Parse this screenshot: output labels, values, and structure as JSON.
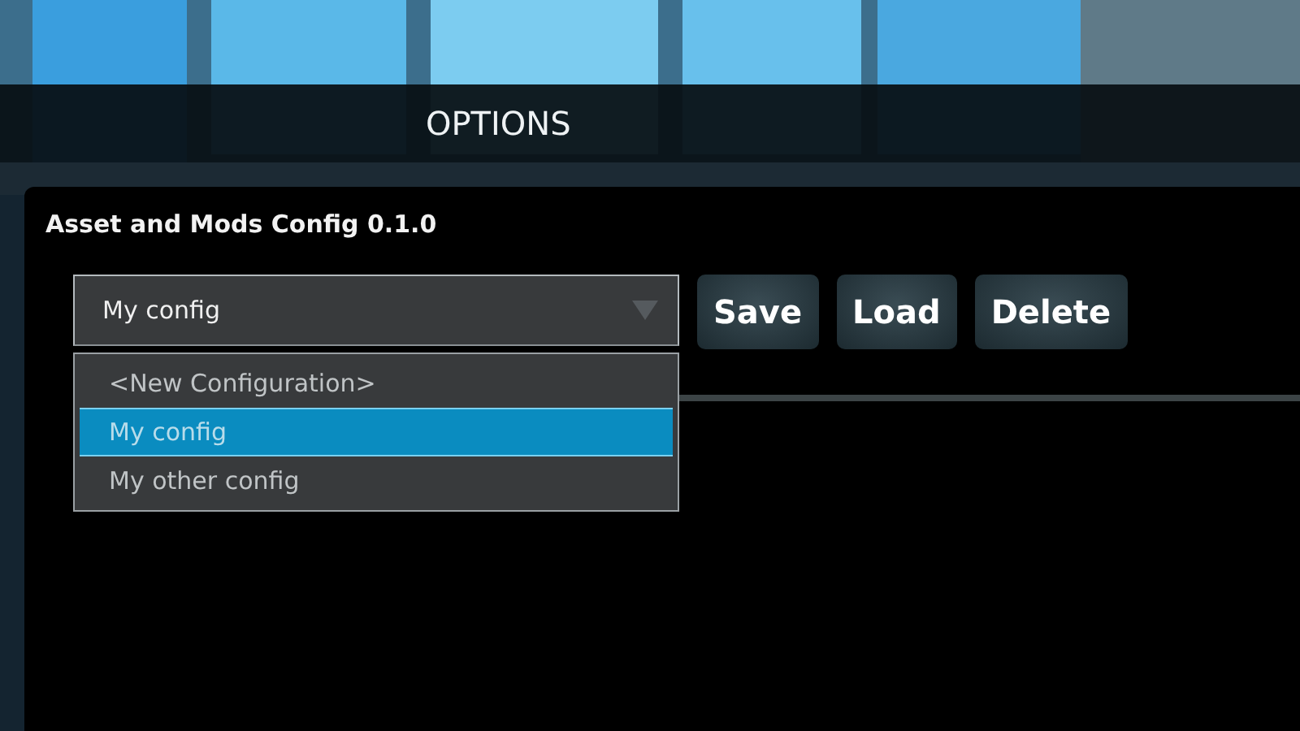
{
  "header": {
    "title": "OPTIONS"
  },
  "panel": {
    "title": "Asset and Mods Config 0.1.0",
    "dropdown": {
      "value": "My config",
      "expanded": true,
      "options": [
        {
          "label": "<New Configuration>",
          "selected": false
        },
        {
          "label": "My config",
          "selected": true
        },
        {
          "label": "My other config",
          "selected": false
        }
      ]
    },
    "buttons": [
      "Save",
      "Load",
      "Delete"
    ]
  }
}
